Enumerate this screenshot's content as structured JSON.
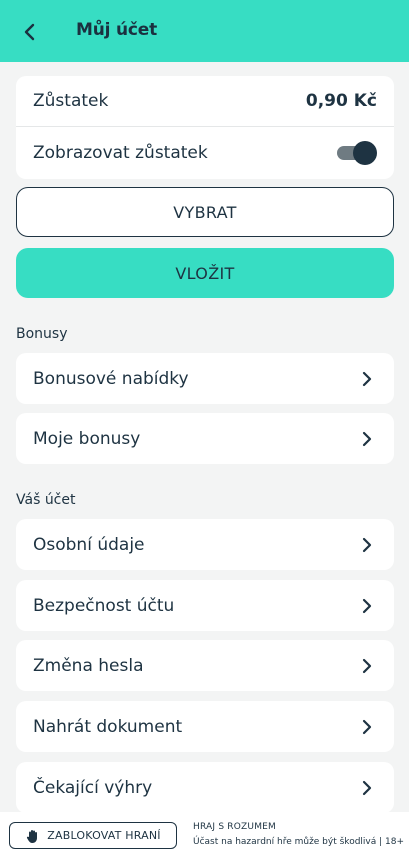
{
  "header": {
    "title": "Můj účet",
    "back_icon": "chevron-left-icon"
  },
  "balance": {
    "label": "Zůstatek",
    "amount": "0,90 Kč",
    "show_label": "Zobrazovat zůstatek",
    "show_enabled": true
  },
  "actions": {
    "withdraw_label": "VYBRAT",
    "deposit_label": "VLOŽIT"
  },
  "bonuses": {
    "section_title": "Bonusy",
    "items": [
      {
        "label": "Bonusové nabídky"
      },
      {
        "label": "Moje bonusy"
      }
    ]
  },
  "account": {
    "section_title": "Váš účet",
    "items": [
      {
        "label": "Osobní údaje"
      },
      {
        "label": "Bezpečnost účtu"
      },
      {
        "label": "Změna hesla"
      },
      {
        "label": "Nahrát dokument"
      },
      {
        "label": "Čekající výhry"
      }
    ]
  },
  "footer": {
    "block_label": "ZABLOKOVAT HRANÍ",
    "block_icon": "hand-stop-icon",
    "notice_title": "HRAJ S ROZUMEM",
    "notice_text": "Účast na hazardní hře může být škodlivá | 18+"
  },
  "colors": {
    "accent": "#37ddc3",
    "text": "#1e3342",
    "background": "#f3f4f4"
  }
}
